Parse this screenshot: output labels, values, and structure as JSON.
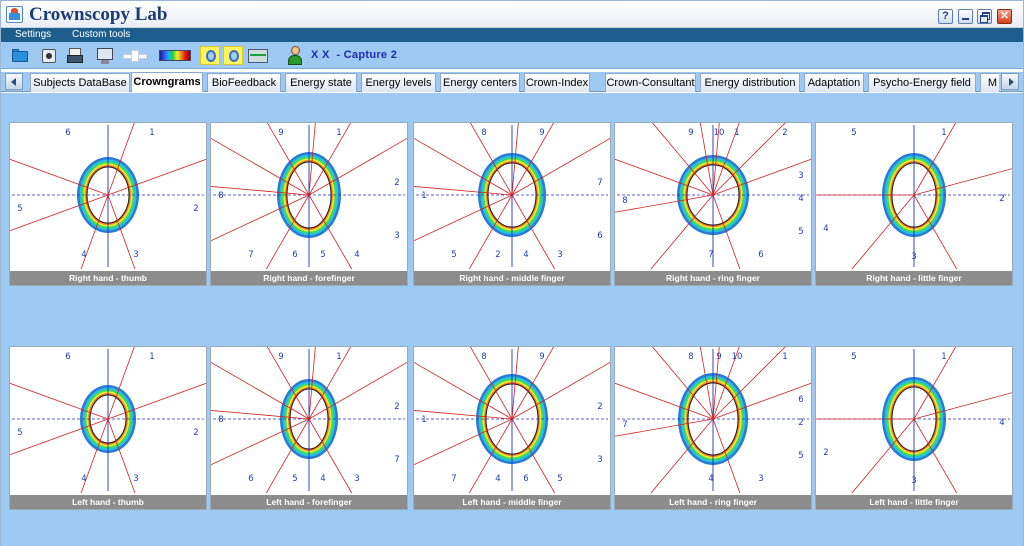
{
  "app": {
    "title": "Crownscopy Lab"
  },
  "window_controls": {
    "help": "?"
  },
  "menu": [
    "Settings",
    "Custom tools"
  ],
  "toolbar": {
    "icons": [
      "folder-icon",
      "camera-icon",
      "print-icon",
      "monitor-camera-icon",
      "plugin-icon",
      "color-spectrum-icon",
      "aura-icon",
      "aura-grid-icon",
      "ecg-monitor-icon",
      "subject-person-icon"
    ]
  },
  "subject": {
    "name": "X X",
    "capture": "- Capture 2"
  },
  "tabs": [
    {
      "label": "Subjects DataBase"
    },
    {
      "label": "Crowngrams",
      "active": true
    },
    {
      "label": "BioFeedback"
    },
    {
      "label": "Energy state"
    },
    {
      "label": "Energy levels"
    },
    {
      "label": "Energy centers"
    },
    {
      "label": "Crown-Index"
    },
    {
      "label": "Crown-Consultant"
    },
    {
      "label": "Energy distribution"
    },
    {
      "label": "Adaptation"
    },
    {
      "label": "Psycho-Energy field"
    },
    {
      "label": "M"
    }
  ],
  "crowngrams": [
    {
      "caption": "Right hand - thumb",
      "sectors": [
        "6",
        "1",
        "5",
        "2",
        "4",
        "3"
      ]
    },
    {
      "caption": "Right hand - forefinger",
      "sectors": [
        "9",
        "1",
        "8",
        "2",
        "3",
        "7",
        "6",
        "5",
        "4"
      ]
    },
    {
      "caption": "Right hand - middle finger",
      "sectors": [
        "8",
        "9",
        "1",
        "7",
        "6",
        "5",
        "2",
        "4",
        "3"
      ]
    },
    {
      "caption": "Right hand - ring finger",
      "sectors": [
        "9",
        "10",
        "1",
        "2",
        "8",
        "3",
        "4",
        "5",
        "7",
        "6"
      ]
    },
    {
      "caption": "Right hand - little finger",
      "sectors": [
        "5",
        "1",
        "2",
        "4",
        "3"
      ]
    },
    {
      "caption": "Left hand - thumb",
      "sectors": [
        "6",
        "1",
        "5",
        "2",
        "4",
        "3"
      ]
    },
    {
      "caption": "Left hand - forefinger",
      "sectors": [
        "9",
        "1",
        "8",
        "2",
        "7",
        "6",
        "5",
        "4",
        "3"
      ]
    },
    {
      "caption": "Left hand - middle finger",
      "sectors": [
        "8",
        "9",
        "1",
        "2",
        "3",
        "7",
        "4",
        "6",
        "5"
      ]
    },
    {
      "caption": "Left hand - ring finger",
      "sectors": [
        "8",
        "9",
        "10",
        "1",
        "7",
        "6",
        "2",
        "5",
        "4",
        "3"
      ]
    },
    {
      "caption": "Left hand - little finger",
      "sectors": [
        "5",
        "1",
        "4",
        "2",
        "3"
      ]
    }
  ],
  "colors": {
    "accent": "#9ec9f2",
    "menubar": "#1e5e8e",
    "sector_lines": "#d42020",
    "axes": "#2030c0",
    "caption_bg": "#8c8c8c"
  }
}
